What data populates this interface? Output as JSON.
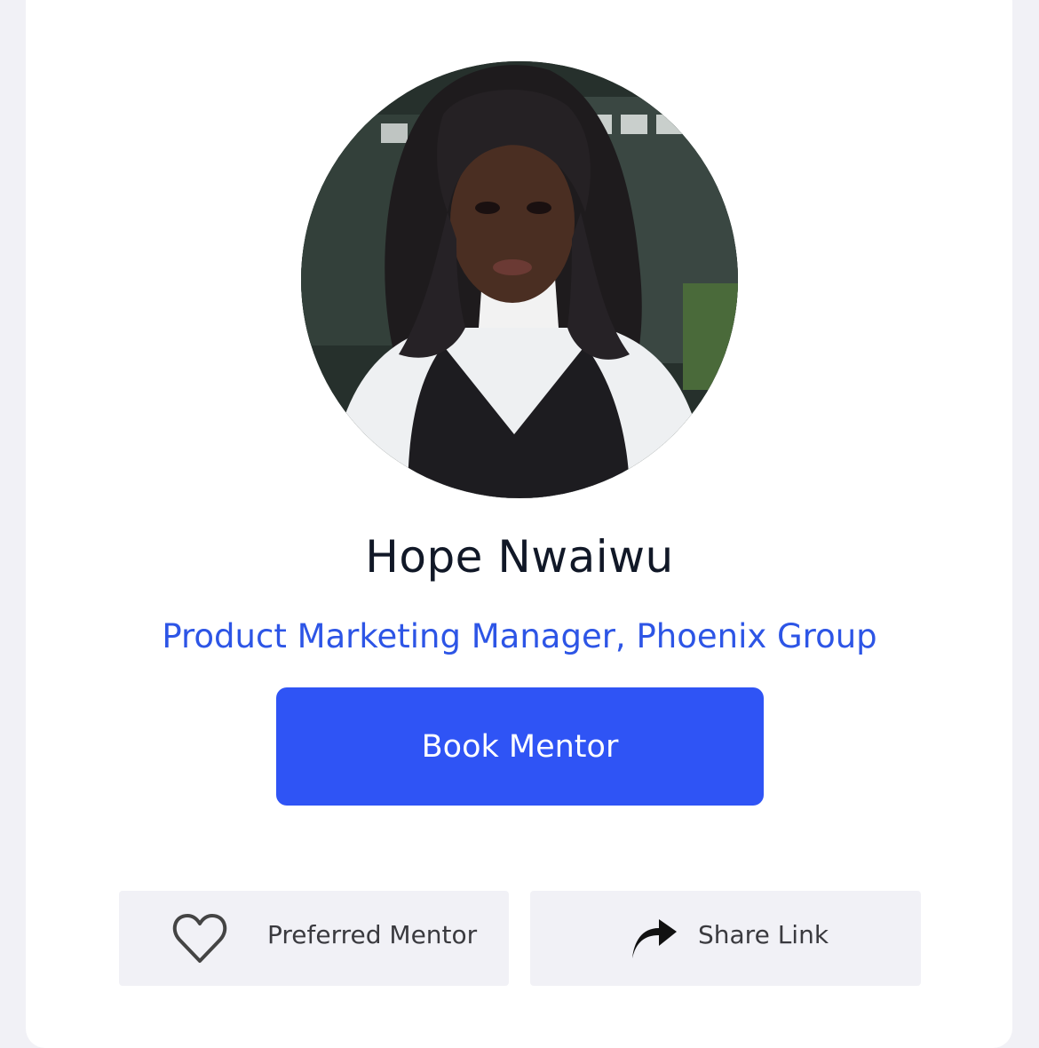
{
  "profile": {
    "name": "Hope Nwaiwu",
    "title": "Product Marketing Manager, Phoenix Group"
  },
  "actions": {
    "book_label": "Book Mentor",
    "preferred_label": "Preferred Mentor",
    "share_label": "Share Link"
  },
  "icons": {
    "preferred": "heart-outline-icon",
    "share": "share-arrow-icon"
  },
  "colors": {
    "accent": "#2f54f5",
    "title_text": "#2d55e6",
    "name_text": "#111827",
    "action_bg": "#f1f1f6"
  }
}
